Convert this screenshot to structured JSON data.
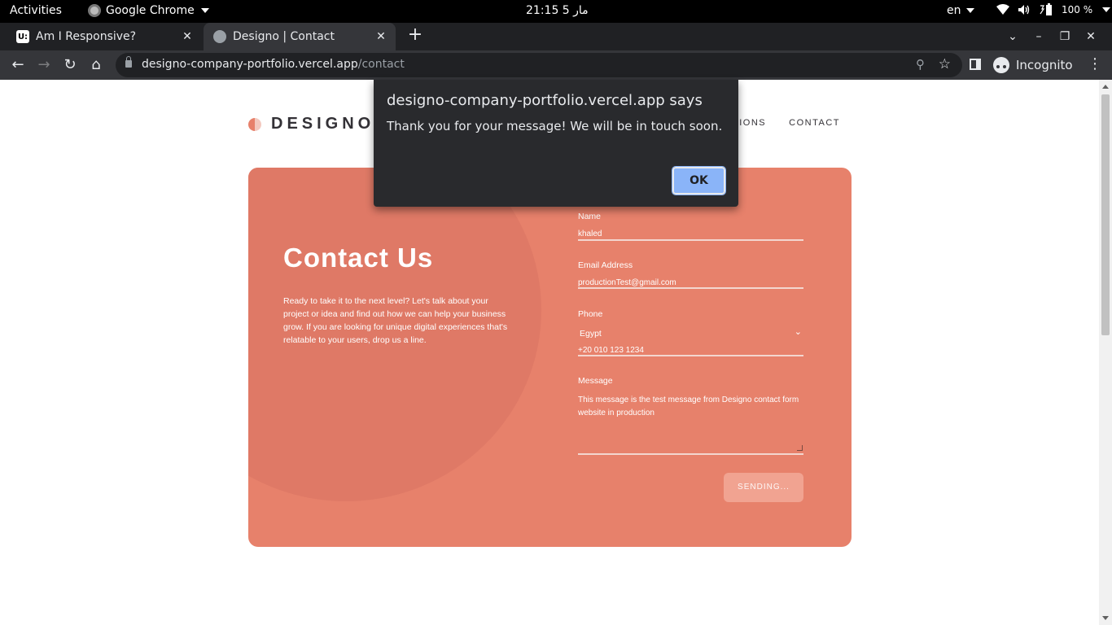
{
  "os": {
    "activities": "Activities",
    "app_name": "Google Chrome",
    "clock": "21:15  5 مار",
    "lang": "en",
    "battery": "100 %"
  },
  "tabs": [
    {
      "title": "Am I Responsive?",
      "favicon": "U:"
    },
    {
      "title": "Designo | Contact"
    }
  ],
  "toolbar": {
    "url_host": "designo-company-portfolio.vercel.app",
    "url_path": "/contact",
    "profile": "Incognito"
  },
  "site": {
    "logo": "DESIGNO",
    "nav": [
      "LOCATIONS",
      "CONTACT"
    ],
    "nav_visible": [
      "CATIONS",
      "CONTACT"
    ]
  },
  "contact": {
    "title": "Contact Us",
    "body": "Ready to take it to the next level? Let's talk about your project or idea and find out how we can help your business grow. If you are looking for unique digital experiences that's relatable to your users, drop us a line."
  },
  "form": {
    "name_label": "Name",
    "name_value": "khaled",
    "email_label": "Email Address",
    "email_value": "productionTest@gmail.com",
    "phone_label": "Phone",
    "country": "Egypt",
    "phone_value": "+20 010 123 1234",
    "message_label": "Message",
    "message_value": "This message is the test message from Designo contact form website in production",
    "submit_label": "SENDING..."
  },
  "alert": {
    "origin": "designo-company-portfolio.vercel.app says",
    "message": "Thank you for your message! We will be in touch soon.",
    "ok": "OK"
  },
  "colors": {
    "brand": "#e7816b",
    "brand_light": "#f2a594",
    "dialog_bg": "#292a2d",
    "ok_button": "#8ab4f8"
  }
}
